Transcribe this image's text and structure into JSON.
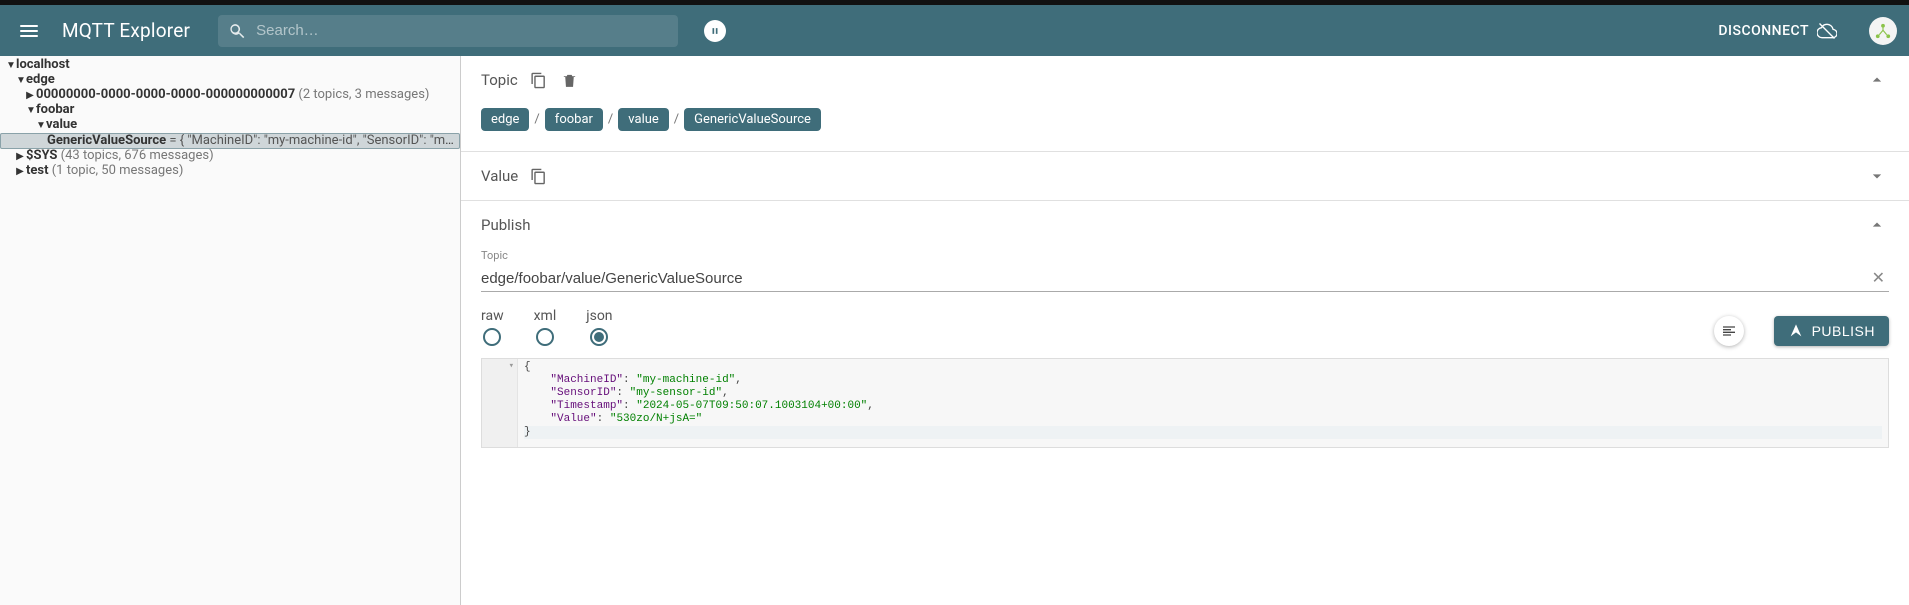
{
  "header": {
    "title": "MQTT Explorer",
    "search_placeholder": "Search…",
    "disconnect_label": "DISCONNECT"
  },
  "tree": {
    "root": "localhost",
    "edge": {
      "name": "edge",
      "child1_name": "00000000-0000-0000-0000-000000000007",
      "child1_stats": "(2 topics, 3 messages)",
      "foobar": {
        "name": "foobar",
        "value": {
          "name": "value",
          "gvs_name": "GenericValueSource",
          "gvs_preview": " = { \"MachineID\": \"my-machine-id\", \"SensorID\": \"my-sensor-i..."
        }
      }
    },
    "sys": {
      "name": "$SYS",
      "stats": "(43 topics, 676 messages)"
    },
    "test": {
      "name": "test",
      "stats": "(1 topic, 50 messages)"
    }
  },
  "detail": {
    "topic_section": "Topic",
    "value_section": "Value",
    "publish_section": "Publish",
    "crumbs": [
      "edge",
      "foobar",
      "value",
      "GenericValueSource"
    ],
    "publish": {
      "topic_label": "Topic",
      "topic_value": "edge/foobar/value/GenericValueSource",
      "format_options": {
        "raw": "raw",
        "xml": "xml",
        "json": "json"
      },
      "selected_format": "json",
      "publish_button": "PUBLISH",
      "payload": {
        "MachineID": "my-machine-id",
        "SensorID": "my-sensor-id",
        "Timestamp": "2024-05-07T09:50:07.1003104+00:00",
        "Value": "530zo/N+jsA="
      }
    }
  }
}
